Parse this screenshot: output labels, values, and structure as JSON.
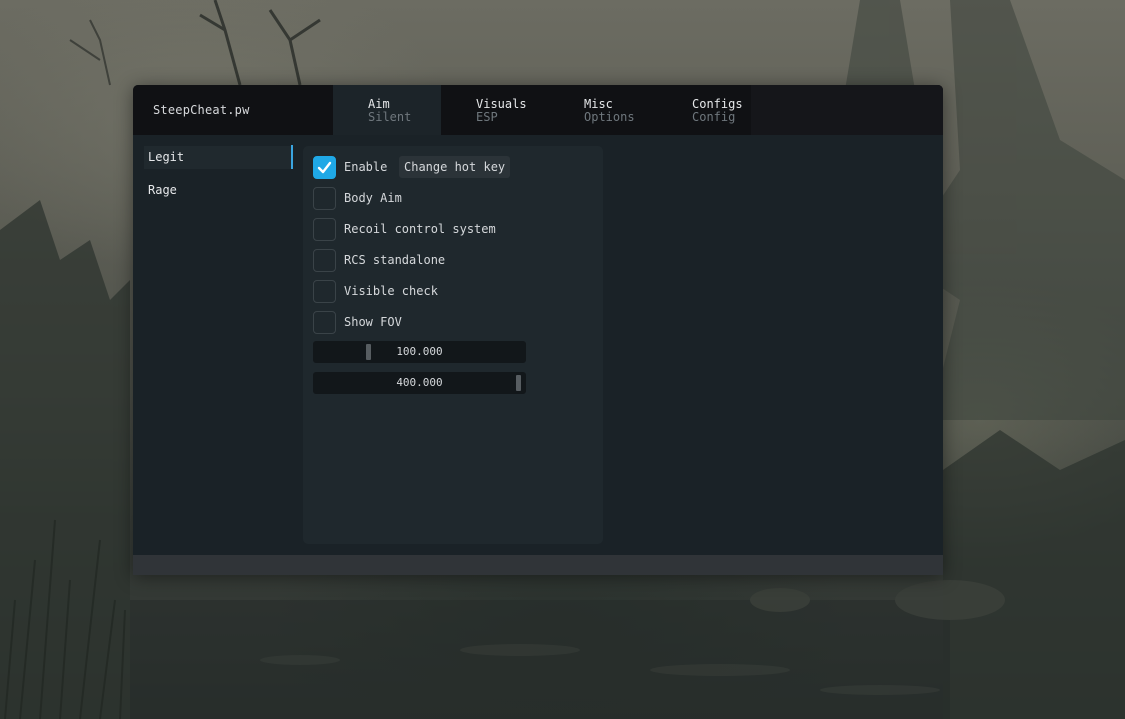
{
  "app": {
    "title": "SteepCheat.pw"
  },
  "tabs": [
    {
      "label": "Aim",
      "sub": "Silent",
      "active": true
    },
    {
      "label": "Visuals",
      "sub": "ESP",
      "active": false
    },
    {
      "label": "Misc",
      "sub": "Options",
      "active": false
    },
    {
      "label": "Configs",
      "sub": "Config",
      "active": false
    }
  ],
  "sidebar": {
    "items": [
      {
        "label": "Legit",
        "active": true
      },
      {
        "label": "Rage",
        "active": false
      }
    ]
  },
  "aim": {
    "options": [
      {
        "label": "Enable",
        "checked": true
      },
      {
        "label": "Body Aim",
        "checked": false
      },
      {
        "label": "Recoil control system",
        "checked": false
      },
      {
        "label": "RCS standalone",
        "checked": false
      },
      {
        "label": "Visible check",
        "checked": false
      },
      {
        "label": "Show FOV",
        "checked": false
      }
    ],
    "hotkey_label": "Change hot key",
    "sliders": [
      {
        "display": "100.000",
        "value": 100,
        "min": 0,
        "max": 400
      },
      {
        "display": "400.000",
        "value": 400,
        "min": 0,
        "max": 400
      }
    ]
  },
  "colors": {
    "accent": "#1fa8e6",
    "active_indicator": "#3aa5e0",
    "window_bg": "#1a2227",
    "titlebar_bg": "#101114"
  },
  "icons": {
    "checkbox_checked": "check-icon"
  }
}
